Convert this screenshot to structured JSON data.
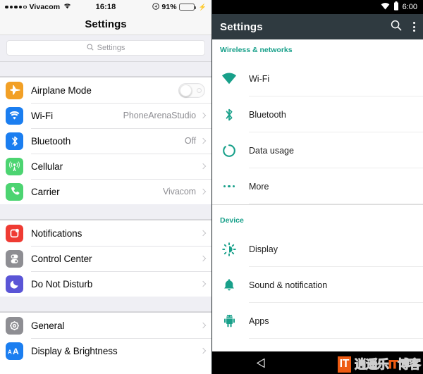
{
  "ios": {
    "status_bar": {
      "signal_dots_filled": 4,
      "signal_dots_total": 5,
      "carrier": "Vivacom",
      "wifi_icon": "wifi-icon",
      "time": "16:18",
      "location_icon": "location-arrow-icon",
      "battery_percent": "91%",
      "battery_level": 91,
      "charging_icon": "lightning-bolt-icon"
    },
    "nav": {
      "title": "Settings"
    },
    "search": {
      "placeholder": "Settings",
      "icon": "search-icon"
    },
    "groups": [
      {
        "rows": [
          {
            "label": "Airplane Mode",
            "icon": "airplane-icon",
            "icon_color": "#f2a026",
            "control": "toggle",
            "toggle_on": false
          },
          {
            "label": "Wi-Fi",
            "icon": "wifi-icon",
            "icon_color": "#1b7ef0",
            "value": "PhoneArenaStudio",
            "control": "chevron"
          },
          {
            "label": "Bluetooth",
            "icon": "bluetooth-icon",
            "icon_color": "#1b7ef0",
            "value": "Off",
            "control": "chevron"
          },
          {
            "label": "Cellular",
            "icon": "cell-tower-icon",
            "icon_color": "#4cd471",
            "value": "",
            "control": "chevron"
          },
          {
            "label": "Carrier",
            "icon": "phone-icon",
            "icon_color": "#4cd471",
            "value": "Vivacom",
            "control": "chevron"
          }
        ]
      },
      {
        "rows": [
          {
            "label": "Notifications",
            "icon": "notifications-icon",
            "icon_color": "#ef3b33",
            "value": "",
            "control": "chevron"
          },
          {
            "label": "Control Center",
            "icon": "control-center-icon",
            "icon_color": "#8e8e93",
            "value": "",
            "control": "chevron"
          },
          {
            "label": "Do Not Disturb",
            "icon": "moon-icon",
            "icon_color": "#5a55d6",
            "value": "",
            "control": "chevron"
          }
        ]
      },
      {
        "rows": [
          {
            "label": "General",
            "icon": "gear-icon",
            "icon_color": "#8e8e93",
            "value": "",
            "control": "chevron"
          },
          {
            "label": "Display & Brightness",
            "icon": "text-size-icon",
            "icon_color": "#1b7ef0",
            "value": "",
            "control": "chevron"
          }
        ]
      }
    ]
  },
  "android": {
    "status_bar": {
      "wifi_icon": "wifi-icon",
      "battery_icon": "battery-icon",
      "time": "6:00"
    },
    "app_bar": {
      "title": "Settings",
      "search_icon": "search-icon",
      "overflow_icon": "kebab-menu-icon"
    },
    "sections": [
      {
        "header": "Wireless & networks",
        "rows": [
          {
            "label": "Wi-Fi",
            "icon": "wifi-icon"
          },
          {
            "label": "Bluetooth",
            "icon": "bluetooth-icon"
          },
          {
            "label": "Data usage",
            "icon": "data-usage-icon"
          },
          {
            "label": "More",
            "icon": "more-dots-icon"
          }
        ]
      },
      {
        "header": "Device",
        "rows": [
          {
            "label": "Display",
            "icon": "brightness-icon"
          },
          {
            "label": "Sound & notification",
            "icon": "bell-icon"
          },
          {
            "label": "Apps",
            "icon": "android-robot-icon"
          }
        ]
      }
    ],
    "nav_bar": {
      "back_icon": "back-triangle-icon"
    },
    "accent_color": "#18a08a",
    "app_bar_color": "#2f3a40"
  },
  "watermark": {
    "logo": "IT",
    "text_part1": "逍遥乐",
    "text_part2": "IT",
    "text_part3": "博客"
  }
}
